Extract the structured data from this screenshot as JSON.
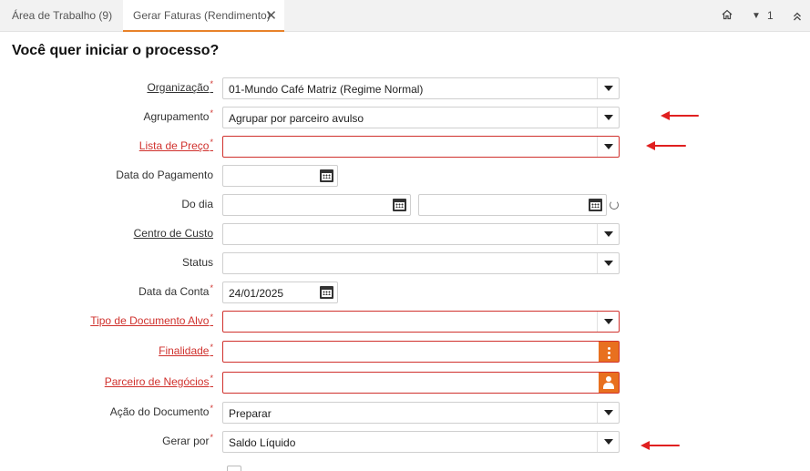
{
  "tabs": [
    {
      "label": "Área de Trabalho (9)"
    },
    {
      "label": "Gerar Faturas (Rendimento)"
    }
  ],
  "toolbar": {
    "count": "1"
  },
  "page": {
    "title": "Você quer iniciar o processo?"
  },
  "form": {
    "organizacao": {
      "label": "Organização",
      "value": "01-Mundo Café Matriz (Regime Normal)"
    },
    "agrupamento": {
      "label": "Agrupamento",
      "value": "Agrupar por parceiro avulso"
    },
    "lista_preco": {
      "label": "Lista de Preço",
      "value": ""
    },
    "data_pagamento": {
      "label": "Data do Pagamento",
      "value": ""
    },
    "do_dia": {
      "label": "Do dia",
      "value_from": "",
      "value_to": ""
    },
    "centro_custo": {
      "label": "Centro de Custo",
      "value": ""
    },
    "status": {
      "label": "Status",
      "value": ""
    },
    "data_conta": {
      "label": "Data da Conta",
      "value": "24/01/2025"
    },
    "tipo_documento": {
      "label": "Tipo de Documento Alvo",
      "value": ""
    },
    "finalidade": {
      "label": "Finalidade",
      "value": ""
    },
    "parceiro": {
      "label": "Parceiro de Negócios",
      "value": ""
    },
    "acao_documento": {
      "label": "Ação do Documento",
      "value": "Preparar"
    },
    "gerar_por": {
      "label": "Gerar por",
      "value": "Saldo Líquido"
    }
  },
  "required_mark": "*",
  "colors": {
    "accent": "#e8701f",
    "error": "#d0312d",
    "annotation_arrow": "#e02020"
  }
}
